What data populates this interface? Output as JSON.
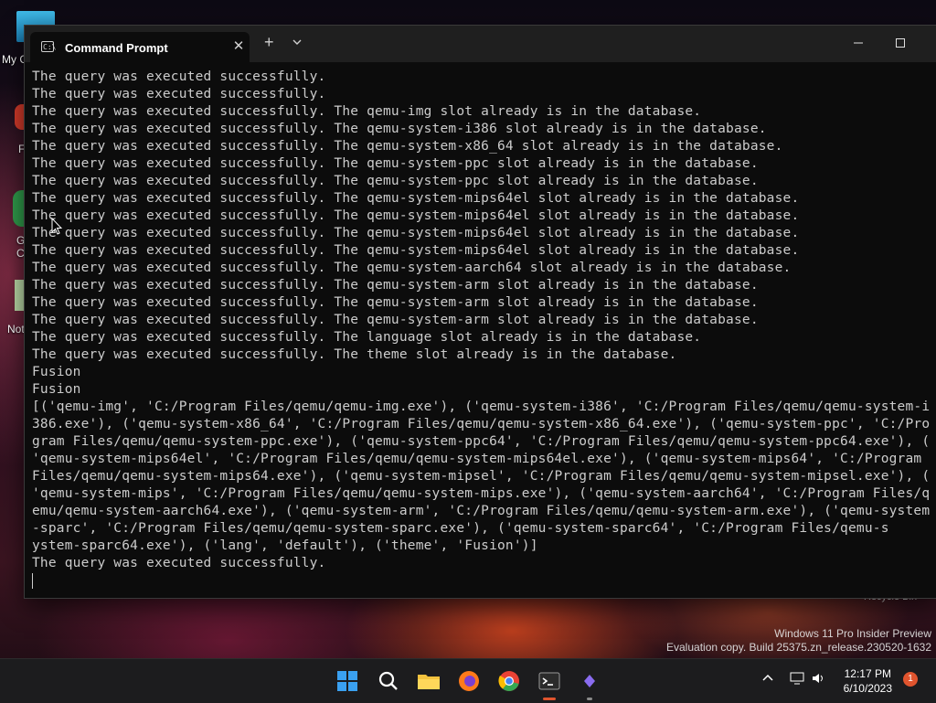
{
  "window": {
    "tab_title": "Command Prompt",
    "tab_close": "✕",
    "new_tab": "+",
    "dropdown": "⌄",
    "minimize": "—",
    "maximize": "☐",
    "close": "✕"
  },
  "console_lines": [
    "The query was executed successfully.",
    "The query was executed successfully.",
    "The query was executed successfully. The qemu-img slot already is in the database.",
    "The query was executed successfully. The qemu-system-i386 slot already is in the database.",
    "The query was executed successfully. The qemu-system-x86_64 slot already is in the database.",
    "The query was executed successfully. The qemu-system-ppc slot already is in the database.",
    "The query was executed successfully. The qemu-system-ppc slot already is in the database.",
    "The query was executed successfully. The qemu-system-mips64el slot already is in the database.",
    "The query was executed successfully. The qemu-system-mips64el slot already is in the database.",
    "The query was executed successfully. The qemu-system-mips64el slot already is in the database.",
    "The query was executed successfully. The qemu-system-mips64el slot already is in the database.",
    "The query was executed successfully. The qemu-system-aarch64 slot already is in the database.",
    "The query was executed successfully. The qemu-system-arm slot already is in the database.",
    "The query was executed successfully. The qemu-system-arm slot already is in the database.",
    "The query was executed successfully. The qemu-system-arm slot already is in the database.",
    "The query was executed successfully. The language slot already is in the database.",
    "The query was executed successfully. The theme slot already is in the database.",
    "Fusion",
    "Fusion",
    "[('qemu-img', 'C:/Program Files/qemu/qemu-img.exe'), ('qemu-system-i386', 'C:/Program Files/qemu/qemu-system-i",
    "386.exe'), ('qemu-system-x86_64', 'C:/Program Files/qemu/qemu-system-x86_64.exe'), ('qemu-system-ppc', 'C:/Pro",
    "gram Files/qemu/qemu-system-ppc.exe'), ('qemu-system-ppc64', 'C:/Program Files/qemu/qemu-system-ppc64.exe'), (",
    "'qemu-system-mips64el', 'C:/Program Files/qemu/qemu-system-mips64el.exe'), ('qemu-system-mips64', 'C:/Program ",
    "Files/qemu/qemu-system-mips64.exe'), ('qemu-system-mipsel', 'C:/Program Files/qemu/qemu-system-mipsel.exe'), (",
    "'qemu-system-mips', 'C:/Program Files/qemu/qemu-system-mips.exe'), ('qemu-system-aarch64', 'C:/Program Files/q",
    "emu/qemu-system-aarch64.exe'), ('qemu-system-arm', 'C:/Program Files/qemu/qemu-system-arm.exe'), ('qemu-system",
    "-sparc', 'C:/Program Files/qemu/qemu-system-sparc.exe'), ('qemu-system-sparc64', 'C:/Program Files/qemu-s",
    "ystem-sparc64.exe'), ('lang', 'default'), ('theme', 'Fusion')]",
    "The query was executed successfully."
  ],
  "desktop": {
    "icon_labels": [
      "My C",
      "F",
      "G",
      "C",
      "Not"
    ],
    "recycle_bin": "Recycle Bin",
    "watermark_line1": "Windows 11 Pro Insider Preview",
    "watermark_line2": "Evaluation copy. Build 25375.zn_release.230520-1632"
  },
  "taskbar": {
    "apps": [
      "start-icon",
      "search-icon",
      "file-explorer-icon",
      "firefox-icon",
      "chrome-icon",
      "terminal-icon",
      "visual-studio-icon"
    ],
    "time": "12:17 PM",
    "date": "6/10/2023",
    "notification_count": "1"
  },
  "colors": {
    "console_bg": "#0c0c0c",
    "console_fg": "#cccccc",
    "titlebar_bg": "#1f1f1f",
    "taskbar_bg": "#1c1c1e",
    "accent": "#e0542e"
  }
}
